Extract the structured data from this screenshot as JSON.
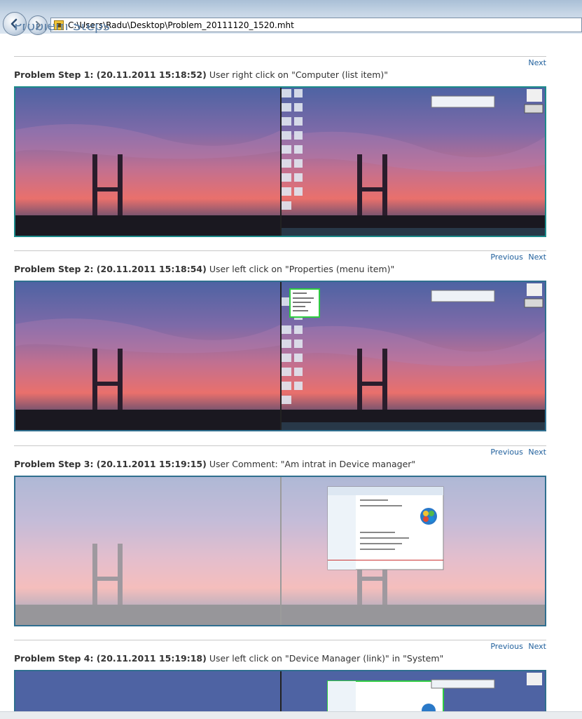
{
  "browser": {
    "address": "C:\\Users\\Radu\\Desktop\\Problem_20111120_1520.mht"
  },
  "page": {
    "heading": "Problem Steps"
  },
  "nav": {
    "previous": "Previous",
    "next": "Next"
  },
  "steps": [
    {
      "title": "Problem Step 1: (20.11.2011 15:18:52)",
      "description": "User right click on \"Computer (list item)\"",
      "has_previous": false
    },
    {
      "title": "Problem Step 2: (20.11.2011 15:18:54)",
      "description": "User left click on \"Properties (menu item)\"",
      "has_previous": true
    },
    {
      "title": "Problem Step 3: (20.11.2011 15:19:15)",
      "description": "User Comment: \"Am intrat in Device manager\"",
      "has_previous": true
    },
    {
      "title": "Problem Step 4: (20.11.2011 15:19:18)",
      "description": "User left click on \"Device Manager (link)\" in \"System\"",
      "has_previous": true
    }
  ],
  "colors": {
    "link": "#1f5f9c",
    "screenshot_border": "#2f6f8f",
    "highlight_border": "#2ecc40"
  },
  "icons": {
    "back": "back-arrow-icon",
    "forward": "forward-arrow-icon",
    "page": "mht-document-icon"
  }
}
